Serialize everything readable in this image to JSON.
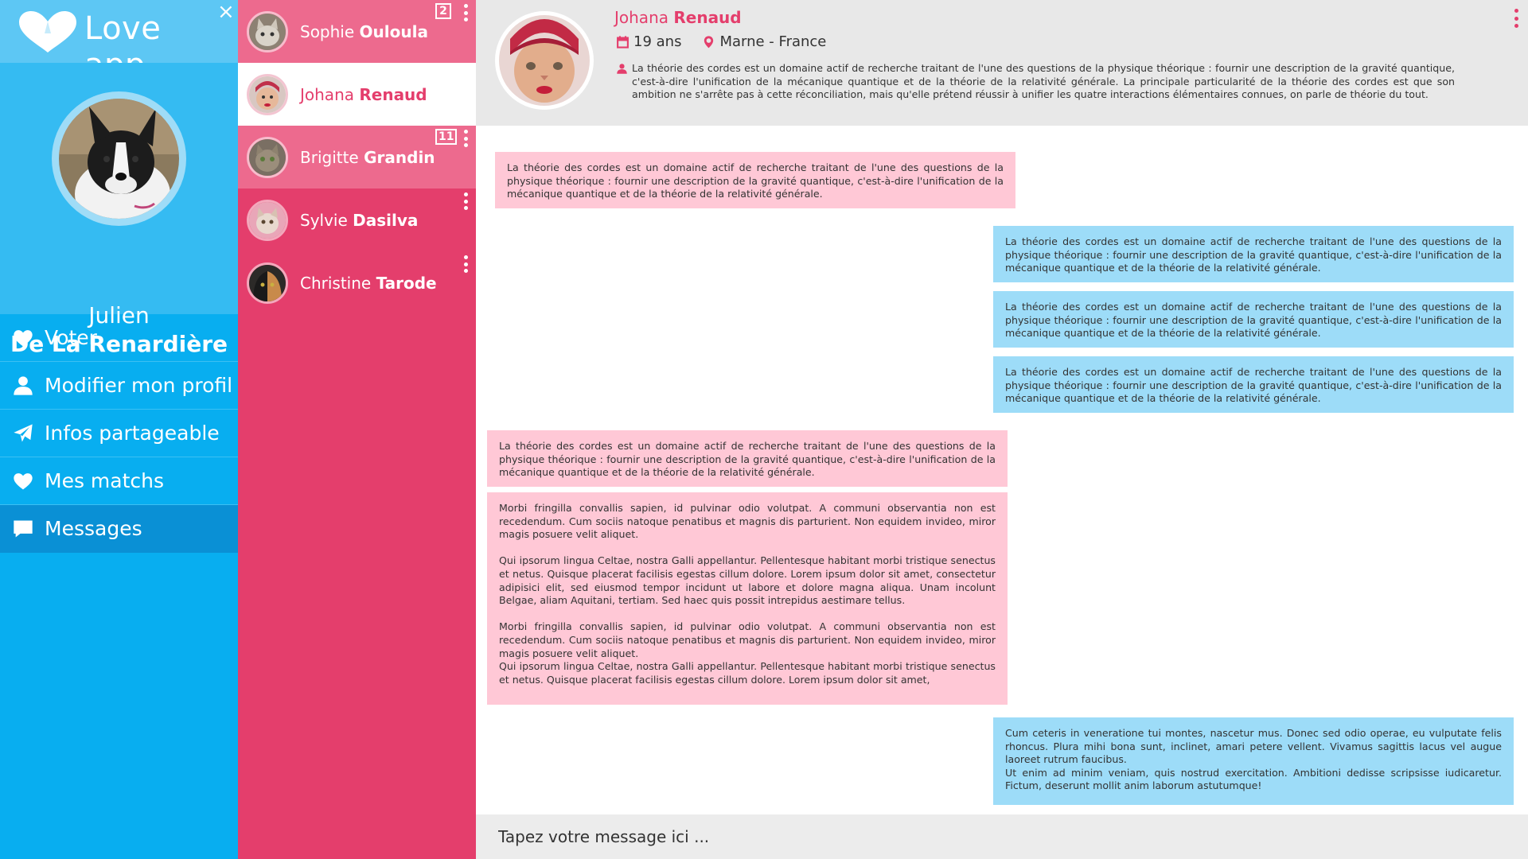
{
  "app": {
    "title": "Love app.",
    "close_label": "×"
  },
  "user": {
    "first_name": "Julien",
    "last_name": "De La Renardière"
  },
  "menu": [
    {
      "label": "Voter",
      "icon": "heart-icon",
      "active": false
    },
    {
      "label": "Modifier mon profil",
      "icon": "user-icon",
      "active": false
    },
    {
      "label": "Infos partageable",
      "icon": "paper-plane-icon",
      "active": false
    },
    {
      "label": "Mes matchs",
      "icon": "heart-icon",
      "active": false
    },
    {
      "label": "Messages",
      "icon": "chat-bubble-icon",
      "active": true
    }
  ],
  "contacts": [
    {
      "first": "Sophie",
      "last": "Ouloula",
      "badge": "2",
      "has_menu": true,
      "selected": false,
      "unread": true
    },
    {
      "first": "Johana",
      "last": "Renaud",
      "badge": "",
      "has_menu": false,
      "selected": true,
      "unread": false
    },
    {
      "first": "Brigitte",
      "last": "Grandin",
      "badge": "11",
      "has_menu": true,
      "selected": false,
      "unread": true
    },
    {
      "first": "Sylvie",
      "last": "Dasilva",
      "badge": "",
      "has_menu": true,
      "selected": false,
      "unread": false
    },
    {
      "first": "Christine",
      "last": "Tarode",
      "badge": "",
      "has_menu": true,
      "selected": false,
      "unread": false
    }
  ],
  "match": {
    "first": "Johana",
    "last": "Renaud",
    "age": "19 ans",
    "location": "Marne - France",
    "bio": "La théorie des cordes est un domaine actif de recherche traitant de l'une des questions de la physique théorique : fournir une description de la gravité quantique, c'est-à-dire l'unification de la mécanique quantique et de la théorie de la relativité générale. La principale particularité de la théorie des cordes est que son ambition ne s'arrête pas à cette réconciliation, mais qu'elle prétend réussir à unifier les quatre interactions élémentaires connues, on parle de théorie du tout."
  },
  "messages": [
    {
      "direction": "in",
      "paragraphs": [
        "La théorie des cordes est un domaine actif de recherche traitant de l'une des questions de la physique théorique : fournir une description de la gravité quantique, c'est-à-dire l'unification de la mécanique quantique et de la théorie de la relativité générale."
      ]
    },
    {
      "direction": "out",
      "paragraphs": [
        "La théorie des cordes est un domaine actif de recherche traitant de l'une des questions de la physique théorique : fournir une description de la gravité quantique, c'est-à-dire l'unification de la mécanique quantique et de la théorie de la relativité générale."
      ]
    },
    {
      "direction": "out",
      "paragraphs": [
        "La théorie des cordes est un domaine actif de recherche traitant de l'une des questions de la physique théorique : fournir une description de la gravité quantique, c'est-à-dire l'unification de la mécanique quantique et de la théorie de la relativité générale."
      ]
    },
    {
      "direction": "out",
      "paragraphs": [
        "La théorie des cordes est un domaine actif de recherche traitant de l'une des questions de la physique théorique : fournir une description de la gravité quantique, c'est-à-dire l'unification de la mécanique quantique et de la théorie de la relativité générale."
      ]
    },
    {
      "direction": "in",
      "paragraphs": [
        "La théorie des cordes est un domaine actif de recherche traitant de l'une des questions de la physique théorique : fournir une description de la gravité quantique, c'est-à-dire l'unification de la mécanique quantique et de la théorie de la relativité générale."
      ]
    },
    {
      "direction": "in",
      "paragraphs": [
        "Morbi fringilla convallis sapien, id pulvinar odio volutpat. A communi observantia non est recedendum. Cum sociis natoque penatibus et magnis dis parturient. Non equidem invideo, miror magis posuere velit aliquet.",
        "Qui ipsorum lingua Celtae, nostra Galli appellantur. Pellentesque habitant morbi tristique senectus et netus. Quisque placerat facilisis egestas cillum dolore. Lorem ipsum dolor sit amet, consectetur adipisici elit, sed eiusmod tempor incidunt ut labore et dolore magna aliqua. Unam incolunt Belgae, aliam Aquitani, tertiam. Sed haec quis possit intrepidus aestimare tellus.",
        "Morbi fringilla convallis sapien, id pulvinar odio volutpat. A communi observantia non est recedendum. Cum sociis natoque penatibus et magnis dis parturient. Non equidem invideo, miror magis posuere velit aliquet.",
        "Qui ipsorum lingua Celtae, nostra Galli appellantur. Pellentesque habitant morbi tristique senectus et netus. Quisque placerat facilisis egestas cillum dolore. Lorem ipsum dolor sit amet,"
      ]
    },
    {
      "direction": "out",
      "paragraphs": [
        "Cum ceteris in veneratione tui montes, nascetur mus. Donec sed odio operae, eu vulputate felis rhoncus. Plura mihi bona sunt, inclinet, amari petere vellent. Vivamus sagittis lacus vel augue laoreet rutrum faucibus.",
        "Ut enim ad minim veniam, quis nostrud exercitation. Ambitioni dedisse scripsisse iudicaretur. Fictum, deserunt mollit anim laborum astutumque!"
      ]
    }
  ],
  "composer": {
    "placeholder": "Tapez votre message ici ..."
  },
  "colors": {
    "nav_blue": "#08aef0",
    "nav_active": "#0a90d5",
    "pink": "#e43e6c",
    "bubble_in": "#ffc8d6",
    "bubble_out": "#9ddcf8"
  }
}
